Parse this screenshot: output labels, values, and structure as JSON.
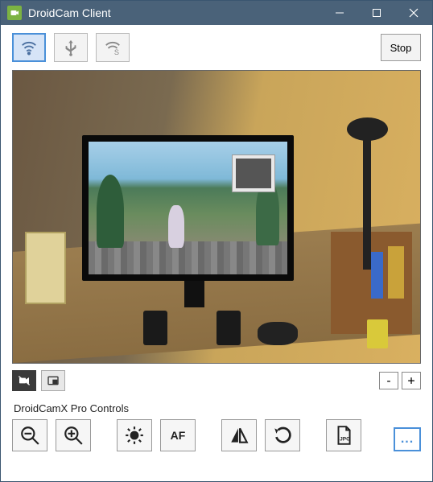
{
  "titlebar": {
    "title": "DroidCam Client"
  },
  "toolbar": {
    "stop_label": "Stop"
  },
  "zoom": {
    "out_label": "-",
    "in_label": "+"
  },
  "pro": {
    "section_label": "DroidCamX Pro Controls",
    "af_label": "AF",
    "more_label": "..."
  }
}
